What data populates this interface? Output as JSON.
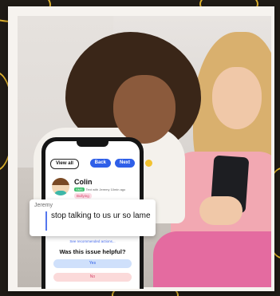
{
  "app": {
    "view_all": "View all",
    "back": "Back",
    "next": "Next",
    "contact_name": "Colin",
    "meta_chip": "SMS",
    "meta_text": "Text with Jeremy 10min ago",
    "tag": "Bullying",
    "recommended_link": "See recommended actions...",
    "question": "Was this issue helpful?",
    "yes": "Yes",
    "no": "No"
  },
  "message": {
    "sender": "Jeremy",
    "text": "stop talking to us ur so lame"
  },
  "colors": {
    "accent": "#2f5fe8",
    "danger": "#d6436a",
    "doodle": "#f2c230"
  }
}
